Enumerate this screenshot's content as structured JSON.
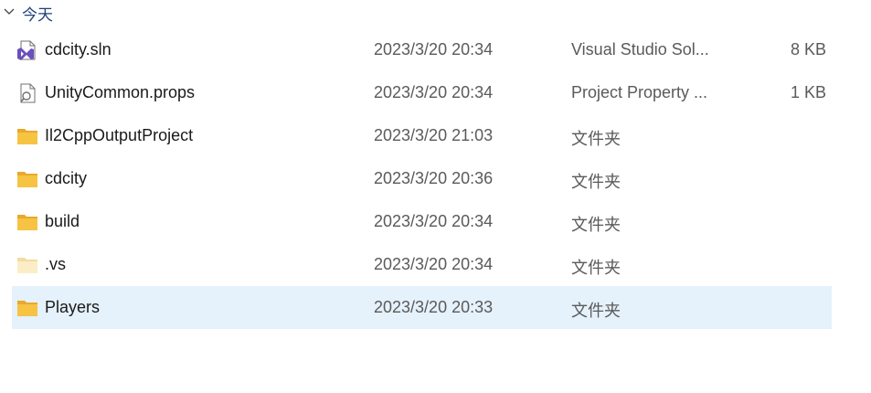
{
  "group": {
    "label": "今天",
    "expanded": true
  },
  "colors": {
    "accent": "#1f3f7a",
    "selection": "#e5f1fb",
    "folder": "#f6c343",
    "vs_purple": "#6b4fbb"
  },
  "files": [
    {
      "name": "cdcity.sln",
      "date": "2023/3/20 20:34",
      "type": "Visual Studio Sol...",
      "size": "8 KB",
      "icon": "vs-solution-icon",
      "selected": false
    },
    {
      "name": "UnityCommon.props",
      "date": "2023/3/20 20:34",
      "type": "Project Property ...",
      "size": "1 KB",
      "icon": "props-file-icon",
      "selected": false
    },
    {
      "name": "Il2CppOutputProject",
      "date": "2023/3/20 21:03",
      "type": "文件夹",
      "size": "",
      "icon": "folder-icon",
      "selected": false
    },
    {
      "name": "cdcity",
      "date": "2023/3/20 20:36",
      "type": "文件夹",
      "size": "",
      "icon": "folder-icon",
      "selected": false
    },
    {
      "name": "build",
      "date": "2023/3/20 20:34",
      "type": "文件夹",
      "size": "",
      "icon": "folder-icon",
      "selected": false
    },
    {
      "name": ".vs",
      "date": "2023/3/20 20:34",
      "type": "文件夹",
      "size": "",
      "icon": "hidden-folder-icon",
      "selected": false
    },
    {
      "name": "Players",
      "date": "2023/3/20 20:33",
      "type": "文件夹",
      "size": "",
      "icon": "folder-icon",
      "selected": true
    }
  ]
}
